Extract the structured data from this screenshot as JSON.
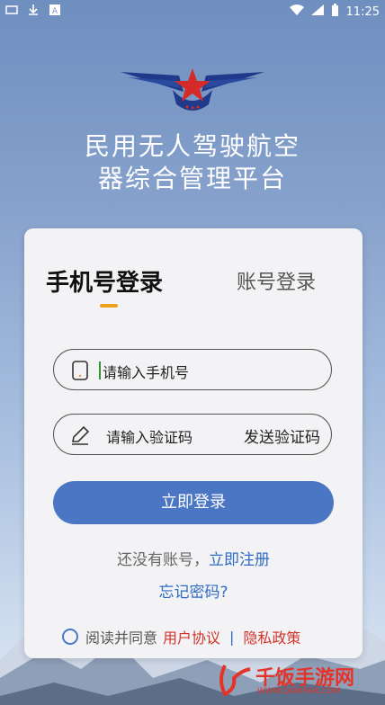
{
  "status_bar": {
    "time": "11:25"
  },
  "title": {
    "line1": "民用无人驾驶航空",
    "line2": "器综合管理平台"
  },
  "tabs": {
    "active": "手机号登录",
    "inactive": "账号登录"
  },
  "phone_field": {
    "placeholder": "请输入手机号"
  },
  "code_field": {
    "placeholder": "请输入验证码",
    "send_label": "发送验证码"
  },
  "login_button": {
    "label": "立即登录"
  },
  "register": {
    "prompt": "还没有账号，",
    "link": "立即注册"
  },
  "forgot": {
    "label": "忘记密码?"
  },
  "agreement": {
    "prefix": "阅读并同意",
    "user_terms": "用户协议",
    "separator": "|",
    "privacy": "隐私政策"
  },
  "watermark": {
    "text": "千饭手游网",
    "sub": "WWW.QIANFAN.COM"
  },
  "colors": {
    "accent": "#4a76c4",
    "link": "#2f6bc2",
    "underline": "#f0a11c",
    "policy": "#d2332b"
  },
  "icons": [
    "download-icon",
    "a-icon",
    "wifi-icon",
    "signal-icon",
    "battery-icon",
    "phone-icon",
    "pencil-icon",
    "radio-icon"
  ]
}
